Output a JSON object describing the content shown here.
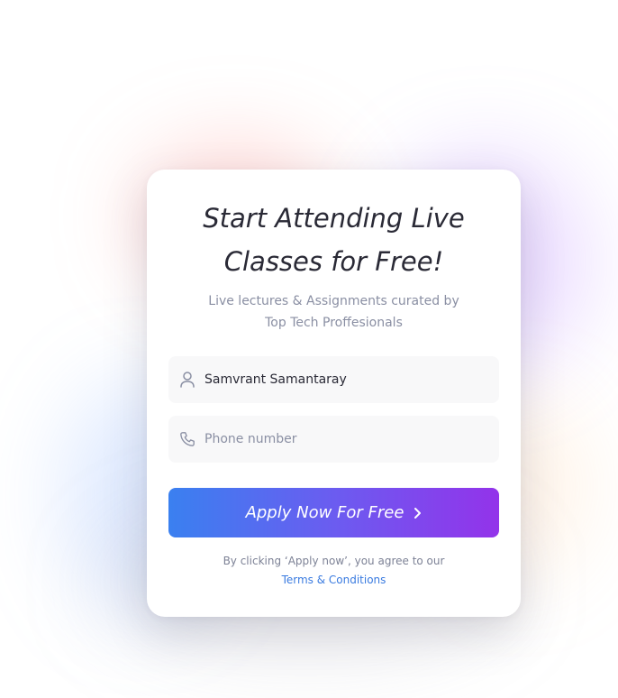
{
  "card": {
    "title_line1": "Start Attending Live",
    "title_line2": "Classes for Free!",
    "subtitle_line1": "Live lectures & Assignments curated by",
    "subtitle_line2": "Top Tech Proffesionals"
  },
  "form": {
    "name_value": "Samvrant Samantaray",
    "name_icon": "user-icon",
    "phone_placeholder": "Phone number",
    "phone_value": "",
    "phone_icon": "phone-icon",
    "apply_label": "Apply Now For Free",
    "apply_icon": "chevron-right-icon"
  },
  "legal": {
    "prefix": "By clicking   ‘Apply now’, you agree to our",
    "link_text": "Terms & Conditions"
  },
  "colors": {
    "gradient_start": "#3a80f0",
    "gradient_end": "#9333ea",
    "link": "#3a7be0",
    "title": "#2a2a36",
    "muted": "#8a8fa3"
  }
}
